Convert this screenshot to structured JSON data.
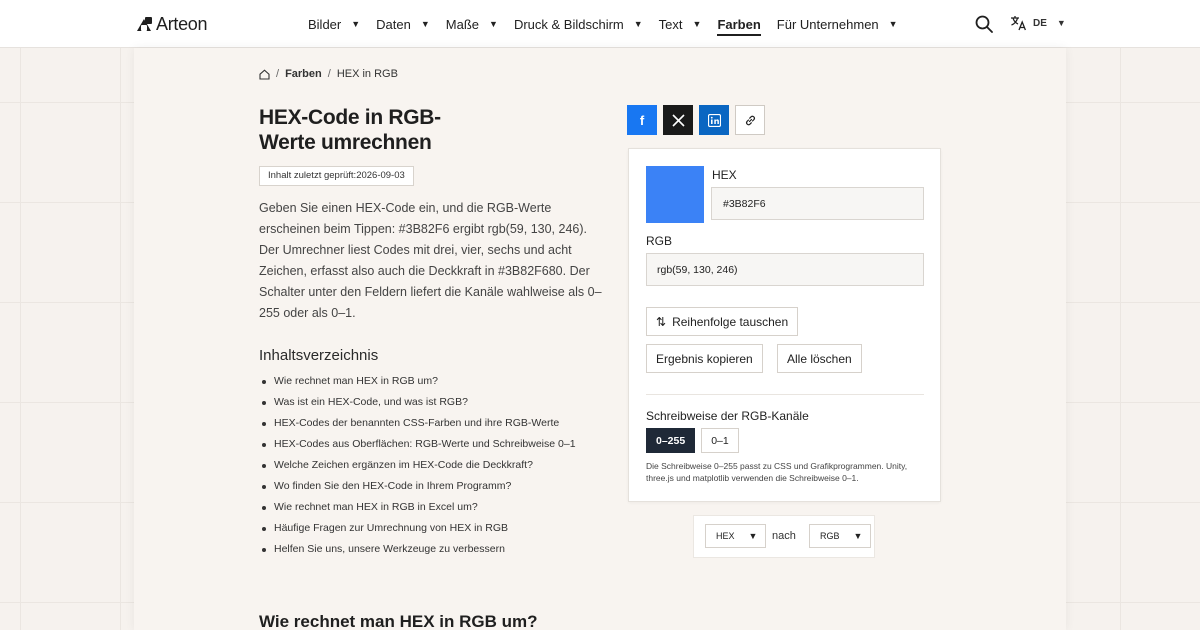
{
  "brand": {
    "name": "Arteon"
  },
  "nav": {
    "items": [
      {
        "label": "Bilder"
      },
      {
        "label": "Daten"
      },
      {
        "label": "Maße"
      },
      {
        "label": "Druck & Bildschirm"
      },
      {
        "label": "Text"
      },
      {
        "label": "Farben"
      },
      {
        "label": "Für Unternehmen"
      }
    ],
    "active": "Farben",
    "language": "DE"
  },
  "breadcrumb": {
    "section": "Farben",
    "current": "HEX in RGB"
  },
  "page": {
    "title_line1": "HEX-Code in RGB-",
    "title_line2": "Werte umrechnen",
    "checked": "Inhalt zuletzt geprüft:2026-09-03",
    "intro": "Geben Sie einen HEX-Code ein, und die RGB-Werte erscheinen beim Tippen: #3B82F6 ergibt rgb(59, 130, 246). Der Umrechner liest Codes mit drei, vier, sechs und acht Zeichen, erfasst also auch die Deckkraft in #3B82F680. Der Schalter unter den Feldern liefert die Kanäle wahlweise als 0–255 oder als 0–1."
  },
  "toc": {
    "heading": "Inhaltsverzeichnis",
    "items": [
      "Wie rechnet man HEX in RGB um?",
      "Was ist ein HEX-Code, und was ist RGB?",
      "HEX-Codes der benannten CSS-Farben und ihre RGB-Werte",
      "HEX-Codes aus Oberflächen: RGB-Werte und Schreibweise 0–1",
      "Welche Zeichen ergänzen im HEX-Code die Deckkraft?",
      "Wo finden Sie den HEX-Code in Ihrem Programm?",
      "Wie rechnet man HEX in RGB in Excel um?",
      "Häufige Fragen zur Umrechnung von HEX in RGB",
      "Helfen Sie uns, unsere Werkzeuge zu verbessern"
    ]
  },
  "section": {
    "heading": "Wie rechnet man HEX in RGB um?"
  },
  "converter": {
    "swatch_color": "#3B82F6",
    "hex_label": "HEX",
    "hex_value": "#3B82F6",
    "rgb_label": "RGB",
    "rgb_value": "rgb(59, 130, 246)",
    "swap_label": "Reihenfolge tauschen",
    "copy_label": "Ergebnis kopieren",
    "clear_label": "Alle löschen",
    "notation_label": "Schreibweise der RGB-Kanäle",
    "notation_options": [
      "0–255",
      "0–1"
    ],
    "notation_selected": "0–255",
    "notation_hint": "Die Schreibweise 0–255 passt zu CSS und Grafikprogrammen. Unity, three.js und matplotlib verwenden die Schreibweise 0–1."
  },
  "direction": {
    "from": "HEX",
    "word": "nach",
    "to": "RGB"
  },
  "colors": {
    "accent_dark": "#1F2937",
    "facebook": "#1877F2",
    "linkedin": "#0A66C2",
    "x": "#1A1A1A"
  },
  "icons": {
    "search": "search-icon",
    "translate": "translate-icon",
    "home": "home-icon",
    "share": [
      "facebook-icon",
      "x-icon",
      "linkedin-icon",
      "link-icon"
    ],
    "swap": "swap-vertical-icon",
    "caret": "chevron-down-icon"
  }
}
